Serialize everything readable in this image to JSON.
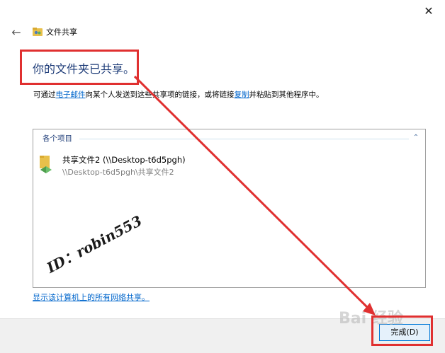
{
  "window": {
    "close_glyph": "✕",
    "back_glyph": "←",
    "title": "文件共享"
  },
  "heading": "你的文件夹已共享。",
  "instruction": {
    "prefix": "可通过",
    "email_link": "电子邮件",
    "middle": "向某个人发送到这些共享项的链接，或将链接",
    "copy_link": "复制",
    "suffix": "并粘贴到其他程序中。"
  },
  "list": {
    "group_label": "各个项目",
    "collapse_glyph": "⌃",
    "items": [
      {
        "name": "共享文件2 (\\\\Desktop-t6d5pgh)",
        "path": "\\\\Desktop-t6d5pgh\\共享文件2"
      }
    ]
  },
  "network_link": "显示该计算机上的所有网络共享。",
  "footer": {
    "done_label": "完成(D)"
  },
  "watermarks": {
    "author": "ID：robin553",
    "baidu": "Bai 经验"
  },
  "colors": {
    "heading": "#1e3c78",
    "link": "#0066cc",
    "annotation": "#e03030",
    "button_border": "#0078d7"
  }
}
